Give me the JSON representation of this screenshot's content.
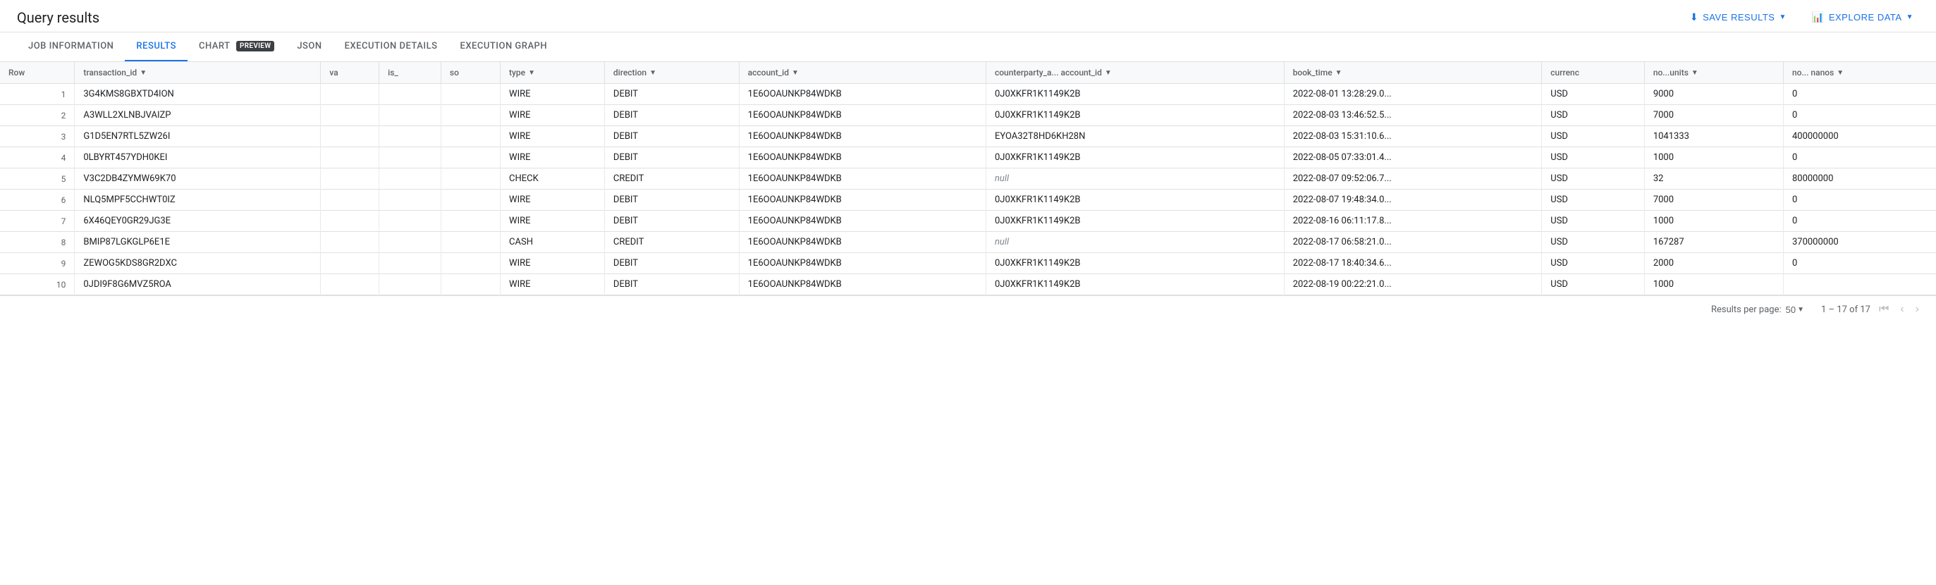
{
  "header": {
    "title": "Query results",
    "save_results_label": "SAVE RESULTS",
    "explore_data_label": "EXPLORE DATA"
  },
  "tabs": [
    {
      "id": "job-information",
      "label": "JOB INFORMATION",
      "active": false
    },
    {
      "id": "results",
      "label": "RESULTS",
      "active": true
    },
    {
      "id": "chart",
      "label": "CHART",
      "active": false,
      "badge": "PREVIEW"
    },
    {
      "id": "json",
      "label": "JSON",
      "active": false
    },
    {
      "id": "execution-details",
      "label": "EXECUTION DETAILS",
      "active": false
    },
    {
      "id": "execution-graph",
      "label": "EXECUTION GRAPH",
      "active": false
    }
  ],
  "table": {
    "columns": [
      {
        "id": "row",
        "label": "Row",
        "sortable": false
      },
      {
        "id": "transaction_id",
        "label": "transaction_id",
        "sortable": true
      },
      {
        "id": "va",
        "label": "va",
        "sortable": false
      },
      {
        "id": "is_",
        "label": "is_",
        "sortable": false
      },
      {
        "id": "so",
        "label": "so",
        "sortable": false
      },
      {
        "id": "type",
        "label": "type",
        "sortable": true
      },
      {
        "id": "direction",
        "label": "direction",
        "sortable": true
      },
      {
        "id": "account_id",
        "label": "account_id",
        "sortable": true
      },
      {
        "id": "counterparty_a_account_id",
        "label": "counterparty_a... account_id",
        "sortable": true
      },
      {
        "id": "book_time",
        "label": "book_time",
        "sortable": true
      },
      {
        "id": "currency",
        "label": "currenc",
        "sortable": false
      },
      {
        "id": "no_units",
        "label": "no...units",
        "sortable": true
      },
      {
        "id": "no_nanos",
        "label": "no... nanos",
        "sortable": true
      }
    ],
    "rows": [
      {
        "row": 1,
        "transaction_id": "3G4KMS8GBXTD4ION",
        "va": "",
        "is_": "",
        "so": "",
        "type": "WIRE",
        "direction": "DEBIT",
        "account_id": "1E6OOAUNKP84WDKB",
        "counterparty_a_account_id": "0J0XKFR1K1149K2B",
        "book_time": "2022-08-01 13:28:29.0...",
        "currency": "USD",
        "no_units": "9000",
        "no_nanos": "0"
      },
      {
        "row": 2,
        "transaction_id": "A3WLL2XLNBJVAIZP",
        "va": "",
        "is_": "",
        "so": "",
        "type": "WIRE",
        "direction": "DEBIT",
        "account_id": "1E6OOAUNKP84WDKB",
        "counterparty_a_account_id": "0J0XKFR1K1149K2B",
        "book_time": "2022-08-03 13:46:52.5...",
        "currency": "USD",
        "no_units": "7000",
        "no_nanos": "0"
      },
      {
        "row": 3,
        "transaction_id": "G1D5EN7RTL5ZW26I",
        "va": "",
        "is_": "",
        "so": "",
        "type": "WIRE",
        "direction": "DEBIT",
        "account_id": "1E6OOAUNKP84WDKB",
        "counterparty_a_account_id": "EYOA32T8HD6KH28N",
        "book_time": "2022-08-03 15:31:10.6...",
        "currency": "USD",
        "no_units": "1041333",
        "no_nanos": "400000000"
      },
      {
        "row": 4,
        "transaction_id": "0LBYRT457YDH0KEI",
        "va": "",
        "is_": "",
        "so": "",
        "type": "WIRE",
        "direction": "DEBIT",
        "account_id": "1E6OOAUNKP84WDKB",
        "counterparty_a_account_id": "0J0XKFR1K1149K2B",
        "book_time": "2022-08-05 07:33:01.4...",
        "currency": "USD",
        "no_units": "1000",
        "no_nanos": "0"
      },
      {
        "row": 5,
        "transaction_id": "V3C2DB4ZYMW69K70",
        "va": "",
        "is_": "",
        "so": "",
        "type": "CHECK",
        "direction": "CREDIT",
        "account_id": "1E6OOAUNKP84WDKB",
        "counterparty_a_account_id": null,
        "book_time": "2022-08-07 09:52:06.7...",
        "currency": "USD",
        "no_units": "32",
        "no_nanos": "80000000"
      },
      {
        "row": 6,
        "transaction_id": "NLQ5MPF5CCHWT0IZ",
        "va": "",
        "is_": "",
        "so": "",
        "type": "WIRE",
        "direction": "DEBIT",
        "account_id": "1E6OOAUNKP84WDKB",
        "counterparty_a_account_id": "0J0XKFR1K1149K2B",
        "book_time": "2022-08-07 19:48:34.0...",
        "currency": "USD",
        "no_units": "7000",
        "no_nanos": "0"
      },
      {
        "row": 7,
        "transaction_id": "6X46QEY0GR29JG3E",
        "va": "",
        "is_": "",
        "so": "",
        "type": "WIRE",
        "direction": "DEBIT",
        "account_id": "1E6OOAUNKP84WDKB",
        "counterparty_a_account_id": "0J0XKFR1K1149K2B",
        "book_time": "2022-08-16 06:11:17.8...",
        "currency": "USD",
        "no_units": "1000",
        "no_nanos": "0"
      },
      {
        "row": 8,
        "transaction_id": "BMIP87LGKGLP6E1E",
        "va": "",
        "is_": "",
        "so": "",
        "type": "CASH",
        "direction": "CREDIT",
        "account_id": "1E6OOAUNKP84WDKB",
        "counterparty_a_account_id": null,
        "book_time": "2022-08-17 06:58:21.0...",
        "currency": "USD",
        "no_units": "167287",
        "no_nanos": "370000000"
      },
      {
        "row": 9,
        "transaction_id": "ZEWOG5KDS8GR2DXC",
        "va": "",
        "is_": "",
        "so": "",
        "type": "WIRE",
        "direction": "DEBIT",
        "account_id": "1E6OOAUNKP84WDKB",
        "counterparty_a_account_id": "0J0XKFR1K1149K2B",
        "book_time": "2022-08-17 18:40:34.6...",
        "currency": "USD",
        "no_units": "2000",
        "no_nanos": "0"
      },
      {
        "row": 10,
        "transaction_id": "0JDI9F8G6MVZ5ROA",
        "va": "",
        "is_": "",
        "so": "",
        "type": "WIRE",
        "direction": "DEBIT",
        "account_id": "1E6OOAUNKP84WDKB",
        "counterparty_a_account_id": "0J0XKFR1K1149K2B",
        "book_time": "2022-08-19 00:22:21.0...",
        "currency": "USD",
        "no_units": "1000",
        "no_nanos": ""
      }
    ]
  },
  "footer": {
    "results_per_page_label": "Results per page:",
    "per_page_value": "50",
    "page_range": "1 – 17 of 17"
  },
  "colors": {
    "accent": "#1a73e8",
    "header_bg": "#f8f9fa",
    "border": "#e0e0e0",
    "text_primary": "#202124",
    "text_secondary": "#5f6368"
  }
}
